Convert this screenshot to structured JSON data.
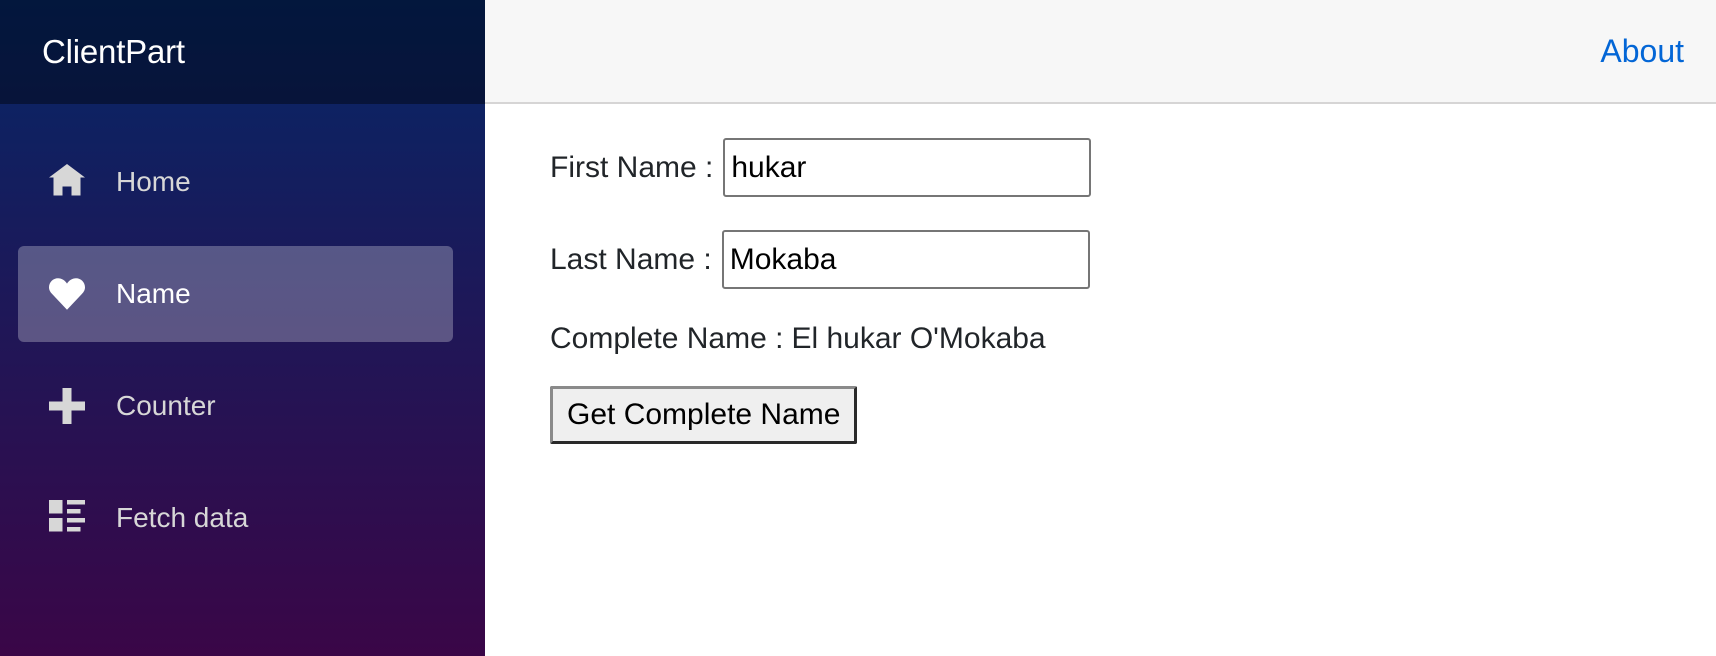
{
  "sidebar": {
    "brand": "ClientPart",
    "items": [
      {
        "label": "Home",
        "icon": "home-icon",
        "active": false
      },
      {
        "label": "Name",
        "icon": "heart-icon",
        "active": true
      },
      {
        "label": "Counter",
        "icon": "plus-icon",
        "active": false
      },
      {
        "label": "Fetch data",
        "icon": "list-rich-icon",
        "active": false
      }
    ]
  },
  "header": {
    "about_label": "About"
  },
  "form": {
    "first_name_label": "First Name :",
    "first_name_value": "hukar",
    "last_name_label": "Last Name :",
    "last_name_value": "Mokaba",
    "complete_name_label": "Complete Name :",
    "complete_name_value": "El hukar O'Mokaba",
    "button_label": "Get Complete Name"
  },
  "colors": {
    "sidebar_top": "#052767",
    "sidebar_bottom": "#3a0647",
    "link": "#0366d6",
    "topbar": "#f7f7f7"
  }
}
